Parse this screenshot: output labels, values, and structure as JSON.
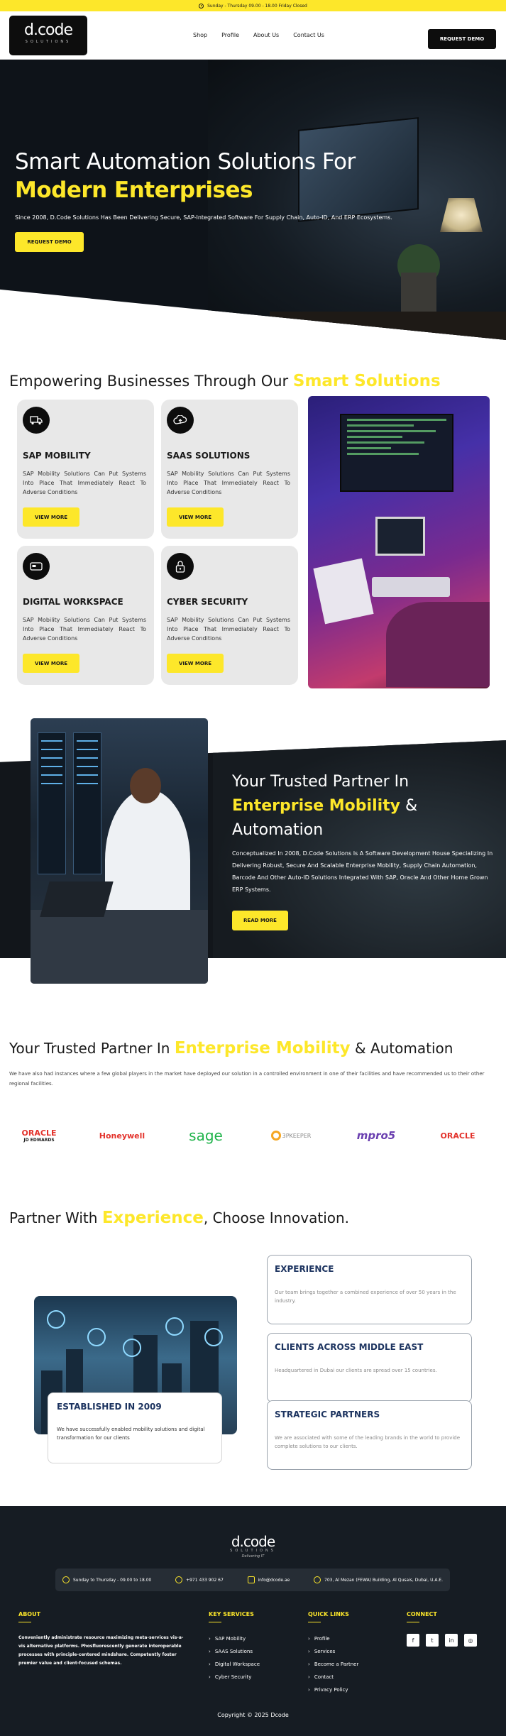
{
  "topbar": {
    "hours": "Sunday - Thursday 09.00 - 18.00 Friday Closed"
  },
  "header": {
    "logo": {
      "brand": "d.code",
      "sub": "SOLUTIONS"
    },
    "nav": [
      "Shop",
      "Profile",
      "About Us",
      "Contact Us"
    ],
    "cta": "REQUEST DEMO"
  },
  "hero": {
    "title_line1": "Smart Automation Solutions For",
    "title_line2": "Modern Enterprises",
    "subtitle": "Since 2008, D.Code Solutions Has Been Delivering Secure, SAP-Integrated Software For Supply Chain, Auto-ID, And ERP Ecosystems.",
    "cta": "REQUEST DEMO"
  },
  "solutions": {
    "title_prefix": "Empowering Businesses Through Our",
    "title_highlight": "Smart Solutions",
    "cards": [
      {
        "icon": "truck-icon",
        "title": "SAP MOBILITY",
        "desc": "SAP Mobility Solutions Can Put Systems Into Place That Immediately React To Adverse Conditions",
        "cta": "VIEW MORE"
      },
      {
        "icon": "cloud-icon",
        "title": "SAAS SOLUTIONS",
        "desc": "SAP Mobility Solutions Can Put Systems Into Place That Immediately React To Adverse Conditions",
        "cta": "VIEW MORE"
      },
      {
        "icon": "card-icon",
        "title": "DIGITAL WORKSPACE",
        "desc": "SAP Mobility Solutions Can Put Systems Into Place That Immediately React To Adverse Conditions",
        "cta": "VIEW MORE"
      },
      {
        "icon": "lock-icon",
        "title": "CYBER SECURITY",
        "desc": "SAP Mobility Solutions Can Put Systems Into Place That Immediately React To Adverse Conditions",
        "cta": "VIEW MORE"
      }
    ]
  },
  "partner": {
    "title_prefix": "Your Trusted Partner In",
    "title_highlight": "Enterprise Mobility",
    "title_suffix": "& Automation",
    "desc": "Conceptualized In 2008, D.Code Solutions Is A Software Development House Specializing In Delivering Robust, Secure And Scalable Enterprise Mobility, Supply Chain Automation, Barcode And Other Auto-ID Solutions Integrated With SAP, Oracle And Other Home Grown ERP Systems.",
    "cta": "READ MORE"
  },
  "trusted": {
    "title_prefix": "Your Trusted Partner In",
    "title_highlight": "Enterprise Mobility",
    "title_suffix": "& Automation",
    "desc": "We have also had instances where a few global players in the market have deployed our solution in a controlled environment in one of their facilities and have recommended us to their other regional facilities.",
    "logos": [
      {
        "name": "ORACLE",
        "sub": "JD EDWARDS",
        "color": "#e3322b"
      },
      {
        "name": "Honeywell",
        "sub": "",
        "color": "#e3322b"
      },
      {
        "name": "sage",
        "sub": "",
        "color": "#1fb34a"
      },
      {
        "name": "3PKEEPER",
        "sub": "",
        "color": "#f5a623"
      },
      {
        "name": "mpro5",
        "sub": "",
        "color": "#6a3fb0"
      },
      {
        "name": "ORACLE",
        "sub": "",
        "color": "#e3322b"
      }
    ]
  },
  "experience": {
    "title_prefix": "Partner With",
    "title_highlight": "Experience",
    "title_suffix": ", Choose Innovation.",
    "established": {
      "title": "ESTABLISHED IN 2009",
      "desc": "We have successfully enabled mobility solutions and digital transformation for our clients"
    },
    "cards": [
      {
        "title": "EXPERIENCE",
        "desc": "Our team brings together a combined experience of over 50 years in the industry."
      },
      {
        "title": "CLIENTS ACROSS MIDDLE EAST",
        "desc": "Headquartered in Dubai our clients are spread over 15 countries."
      },
      {
        "title": "STRATEGIC PARTNERS",
        "desc": "We are associated with some of the leading brands in the world to provide complete solutions to our clients."
      }
    ]
  },
  "footer": {
    "logo": {
      "brand": "d.code",
      "sub": "SOLUTIONS",
      "tag": "Delivering IT"
    },
    "info": {
      "hours": "Sunday to Thursday - 09.00 to 18.00",
      "phone": "+971 433 902 67",
      "email": "info@dcode.ae",
      "address": "703, Al Mezan (FEWA) Building, Al Qusais, Dubai, U.A.E."
    },
    "about": {
      "heading": "ABOUT",
      "text": "Conveniently administrate resource maximizing meta-services vis-a-vis alternative platforms. Phosfluorescently generate interoperable processes with principle-centered mindshare. Competently foster premier value and client-focused schemas."
    },
    "services": {
      "heading": "KEY SERVICES",
      "items": [
        "SAP Mobility",
        "SAAS Solutions",
        "Digital Workspace",
        "Cyber Security"
      ]
    },
    "links": {
      "heading": "QUICK LINKS",
      "items": [
        "Profile",
        "Services",
        "Become a Partner",
        "Contact",
        "Privacy Policy"
      ]
    },
    "connect": {
      "heading": "CONNECT",
      "icons": [
        "facebook-icon",
        "twitter-icon",
        "linkedin-icon",
        "instagram-icon"
      ]
    },
    "copyright": "Copyright © 2025 Dcode"
  }
}
